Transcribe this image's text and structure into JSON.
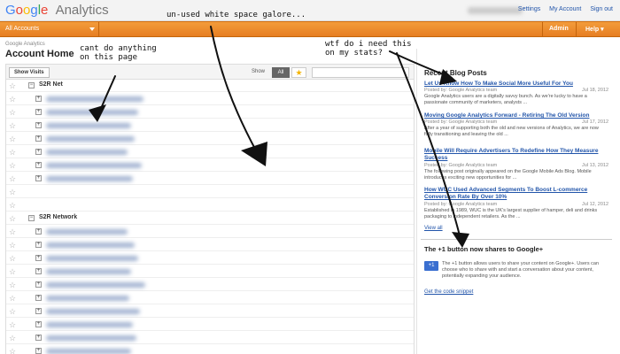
{
  "app": {
    "logo_brand": "Google",
    "logo_product": "Analytics",
    "links": [
      "Settings",
      "My Account",
      "Sign out"
    ]
  },
  "nav": {
    "account_selector": "All Accounts",
    "admin": "Admin",
    "help": "Help"
  },
  "page": {
    "subtitle": "Google Analytics",
    "title": "Account Home"
  },
  "toolbar": {
    "show_visits": "Show Visits",
    "show_label": "Show",
    "filter_all": "All",
    "filter_starred_icon": "star-icon"
  },
  "accounts": [
    {
      "name": "S2R Net",
      "properties": 7
    },
    {
      "name": "S2R Network",
      "properties": 10
    }
  ],
  "blog": {
    "heading": "Recent Blog Posts",
    "posts": [
      {
        "title": "Let Us Know How To Make Social More Useful For You",
        "author": "Posted by: Google Analytics team",
        "date": "Jul 18, 2012",
        "excerpt": "Google Analytics users are a digitally savvy bunch. As we're lucky to have a passionate community of marketers, analysts ..."
      },
      {
        "title": "Moving Google Analytics Forward - Retiring The Old Version",
        "author": "Posted by: Google Analytics team",
        "date": "Jul 17, 2012",
        "excerpt": "After a year of supporting both the old and new versions of Analytics, we are now fully transitioning and leaving the old ..."
      },
      {
        "title": "Mobile Will Require Advertisers To Redefine How They Measure Success",
        "author": "Posted by: Google Analytics team",
        "date": "Jul 13, 2012",
        "excerpt": "The following post originally appeared on the Google Mobile Ads Blog. Mobile introduces exciting new opportunities for ..."
      },
      {
        "title": "How WUC Used Advanced Segments To Boost L-commerce Conversion Rate By Over 10%",
        "author": "Posted by: Google Analytics team",
        "date": "Jul 12, 2012",
        "excerpt": "Established in 1989, WUC is the UK's largest supplier of hamper, deli and drinks packaging to independent retailers. As the ..."
      }
    ],
    "view_all": "View all"
  },
  "plus_one": {
    "heading": "The +1 button now shares to Google+",
    "icon_label": "+1",
    "body": "The +1 button allows users to share your content on Google+. Users can choose who to share with and start a conversation about your content, potentially expanding your audience.",
    "link": "Get the code snippet"
  },
  "annotations": {
    "whitespace": "un-used white space galore...",
    "cant_do": [
      "cant do anything",
      "on this page"
    ],
    "wtf": [
      "wtf do i need this",
      "on my stats?"
    ]
  }
}
